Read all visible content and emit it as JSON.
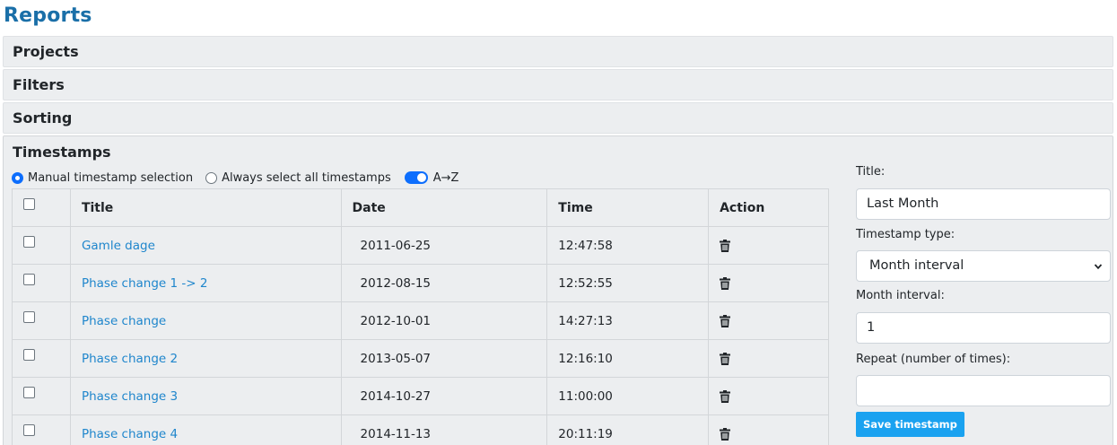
{
  "page": {
    "title": "Reports"
  },
  "sections": {
    "projects": "Projects",
    "filters": "Filters",
    "sorting": "Sorting",
    "timestamps": "Timestamps"
  },
  "mode": {
    "manual_label": "Manual timestamp selection",
    "all_label": "Always select all timestamps",
    "sort_label": "A→Z",
    "selected": "manual",
    "sort_on": true
  },
  "table": {
    "headers": {
      "title": "Title",
      "date": "Date",
      "time": "Time",
      "action": "Action"
    },
    "rows": [
      {
        "title": "Gamle dage",
        "date": "2011-06-25",
        "time": "12:47:58"
      },
      {
        "title": "Phase change 1 -> 2",
        "date": "2012-08-15",
        "time": "12:52:55"
      },
      {
        "title": "Phase change",
        "date": "2012-10-01",
        "time": "14:27:13"
      },
      {
        "title": "Phase change 2",
        "date": "2013-05-07",
        "time": "12:16:10"
      },
      {
        "title": "Phase change 3",
        "date": "2014-10-27",
        "time": "11:00:00"
      },
      {
        "title": "Phase change 4",
        "date": "2014-11-13",
        "time": "20:11:19"
      }
    ]
  },
  "form": {
    "title_label": "Title:",
    "title_value": "Last Month",
    "type_label": "Timestamp type:",
    "type_value": "Month interval",
    "interval_label": "Month interval:",
    "interval_value": "1",
    "repeat_label": "Repeat (number of times):",
    "repeat_value": "",
    "save_label": "Save timestamp"
  },
  "icons": {
    "row_action": "trash-icon",
    "select_toggle": "chevron-down-icon"
  },
  "colors": {
    "heading": "#1a6fa8",
    "link": "#1f86cc",
    "accent": "#0d6efd",
    "button": "#1aa2f0",
    "panel": "#eceef0"
  }
}
